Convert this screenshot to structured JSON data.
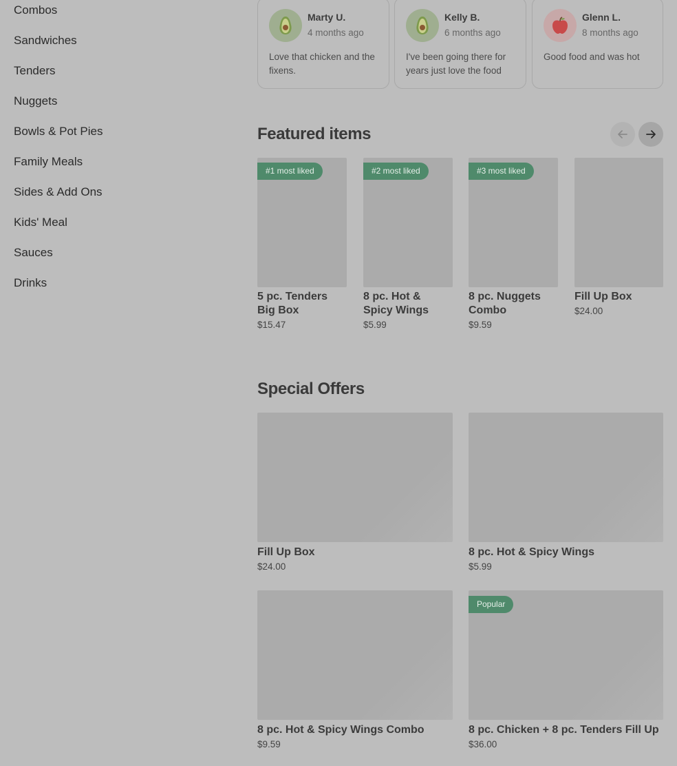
{
  "sidebar": {
    "items": [
      {
        "label": "Combos"
      },
      {
        "label": "Sandwiches"
      },
      {
        "label": "Tenders"
      },
      {
        "label": "Nuggets"
      },
      {
        "label": "Bowls & Pot Pies"
      },
      {
        "label": "Family Meals"
      },
      {
        "label": "Sides & Add Ons"
      },
      {
        "label": "Kids' Meal"
      },
      {
        "label": "Sauces"
      },
      {
        "label": "Drinks"
      }
    ]
  },
  "reviews": [
    {
      "name": "Marty U.",
      "time": "4 months ago",
      "text": "Love that chicken and the fixens.",
      "avatar": "avocado-icon"
    },
    {
      "name": "Kelly B.",
      "time": "6 months ago",
      "text": "I've been going there for years just love the food",
      "avatar": "avocado-icon"
    },
    {
      "name": "Glenn L.",
      "time": "8 months ago",
      "text": "Good food and was hot",
      "avatar": "apple-icon"
    }
  ],
  "featured": {
    "title": "Featured items",
    "items": [
      {
        "badge": "#1 most liked",
        "name": "5 pc. Tenders Big Box",
        "price": "$15.47"
      },
      {
        "badge": "#2 most liked",
        "name": "8 pc. Hot & Spicy Wings",
        "price": "$5.99"
      },
      {
        "badge": "#3 most liked",
        "name": "8 pc. Nuggets Combo",
        "price": "$9.59"
      },
      {
        "badge": "",
        "name": "Fill Up Box",
        "price": "$24.00"
      }
    ]
  },
  "offers": {
    "title": "Special Offers",
    "items": [
      {
        "badge": "",
        "name": "Fill Up Box",
        "price": "$24.00"
      },
      {
        "badge": "",
        "name": "8 pc. Hot & Spicy Wings",
        "price": "$5.99"
      },
      {
        "badge": "",
        "name": "8 pc. Hot & Spicy Wings Combo",
        "price": "$9.59"
      },
      {
        "badge": "Popular",
        "name": "8 pc. Chicken + 8 pc. Tenders Fill Up",
        "price": "$36.00"
      }
    ]
  },
  "colors": {
    "background": "#bdbdbd",
    "badge": "#4f8a6b"
  }
}
